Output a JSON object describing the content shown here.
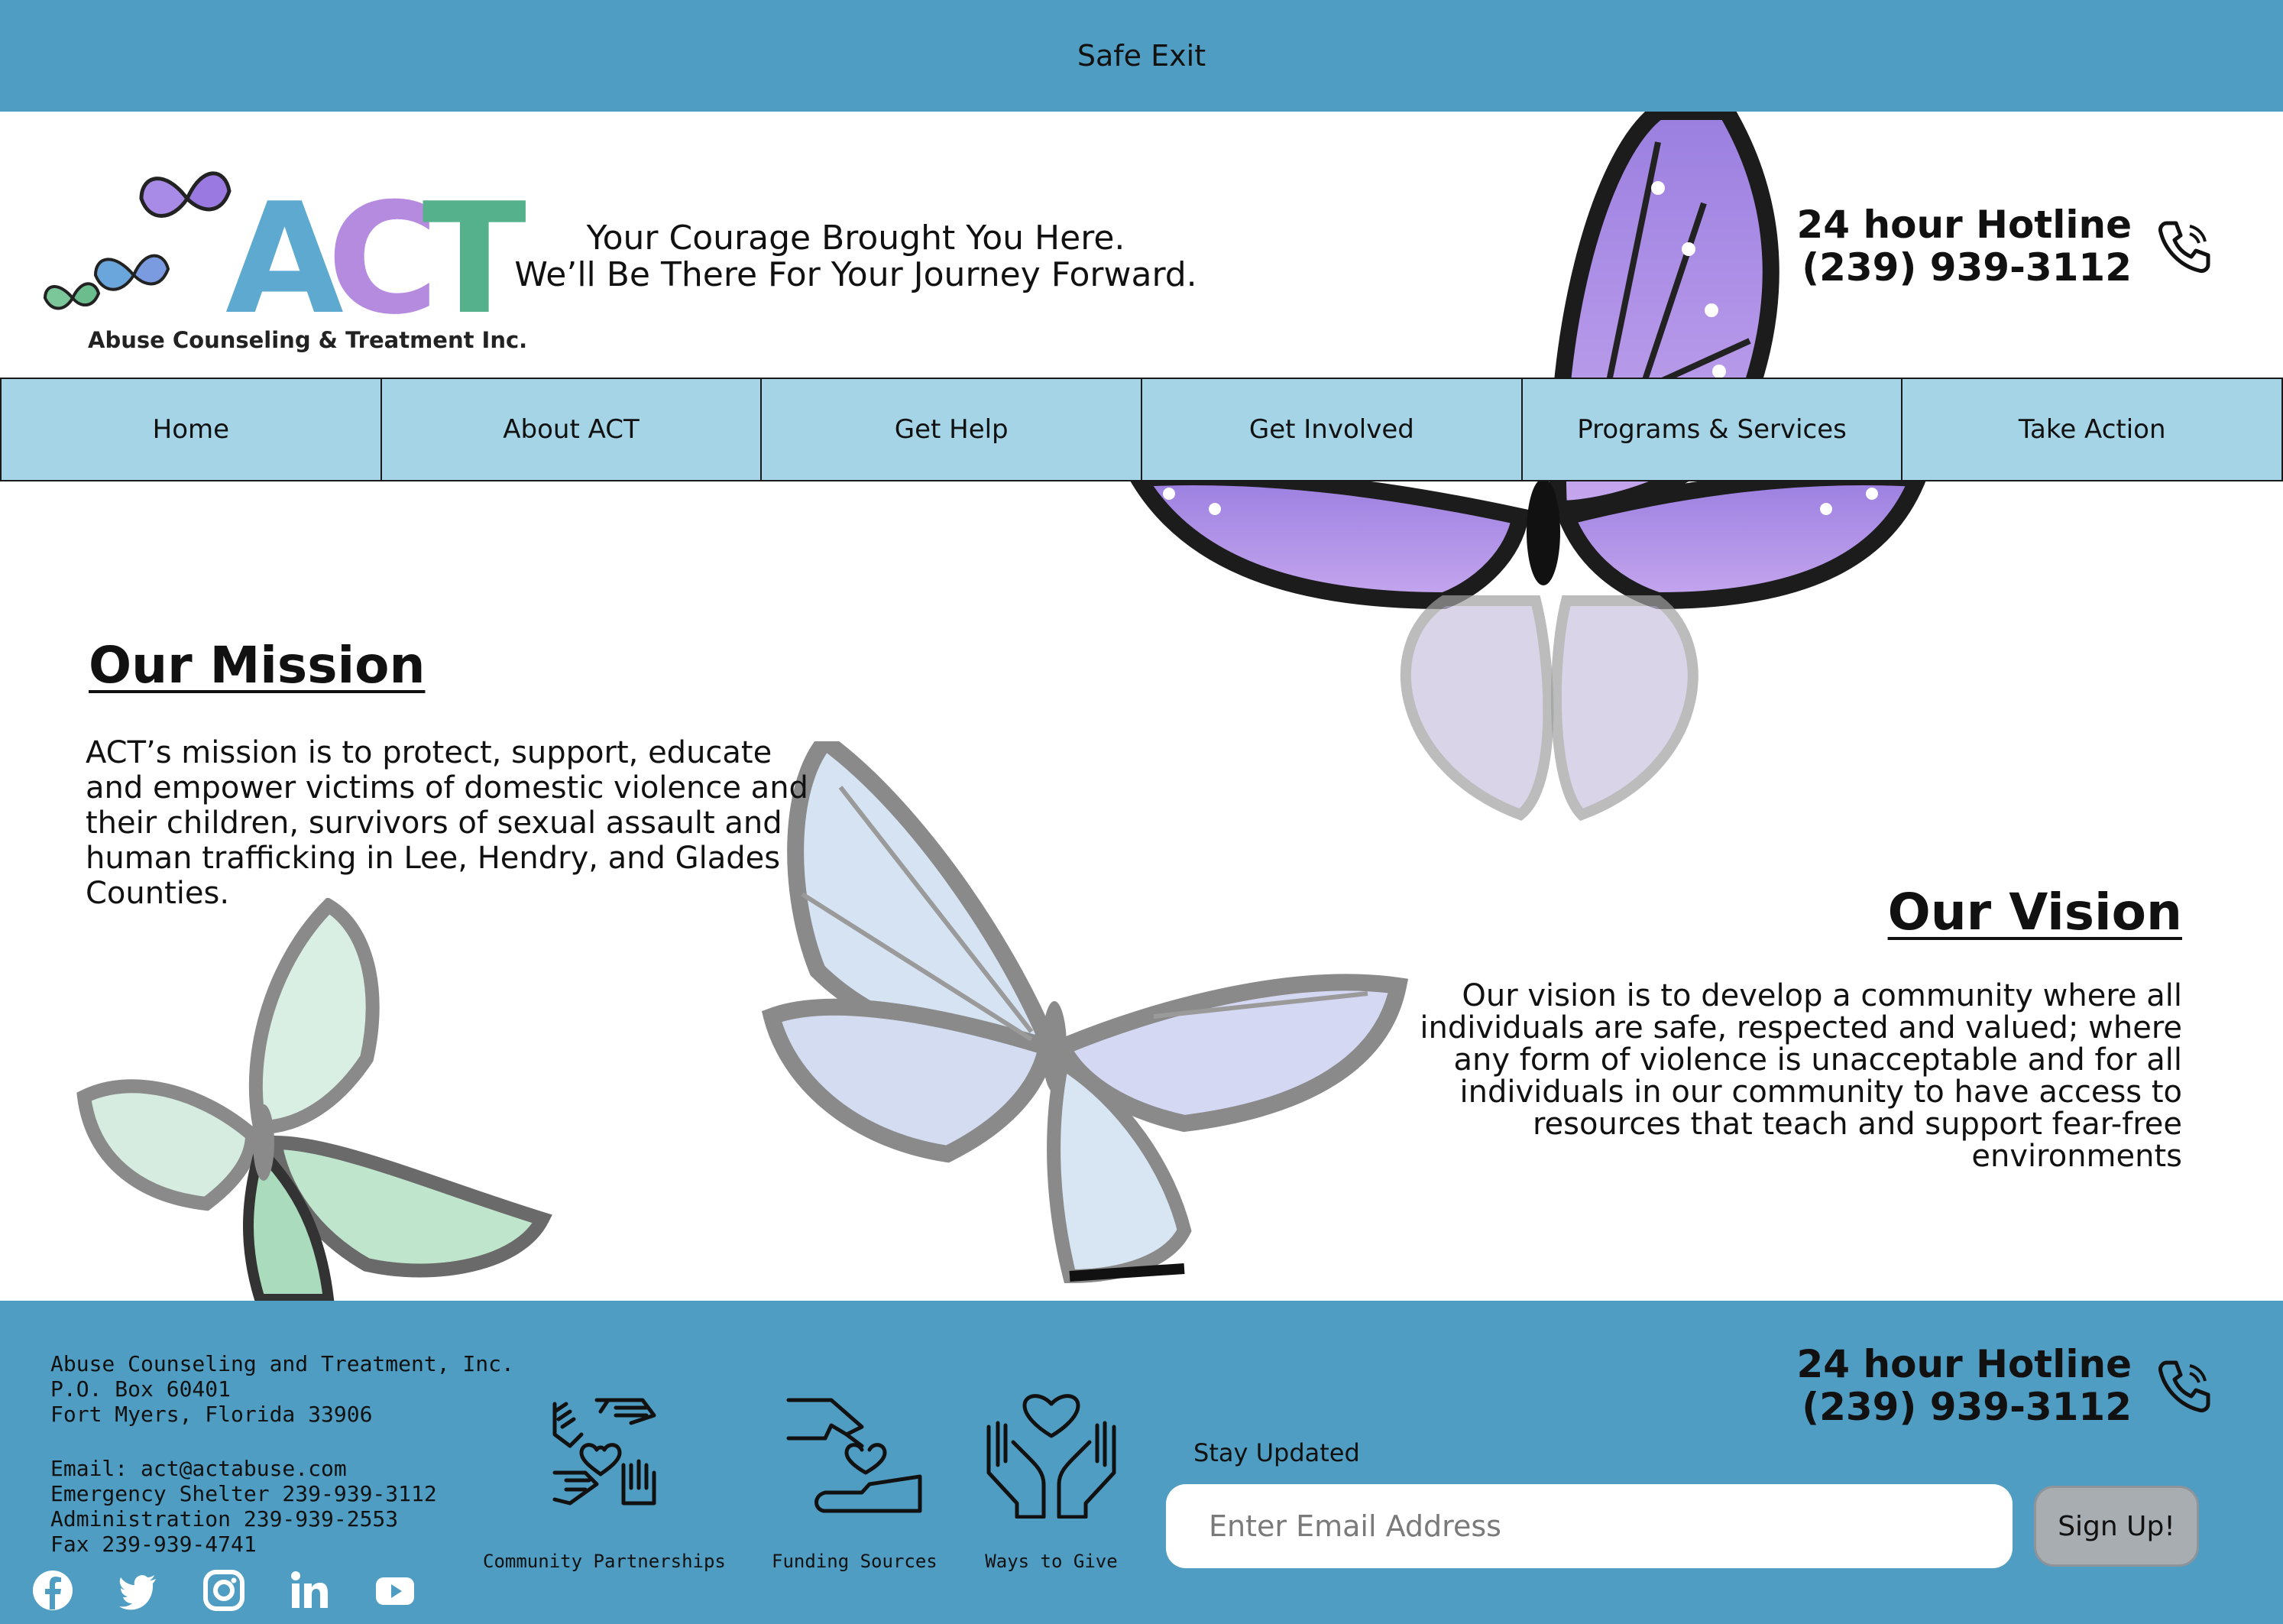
{
  "top_bar": {
    "safe_exit_label": "Safe Exit"
  },
  "header": {
    "logo": {
      "letters": [
        "A",
        "C",
        "T"
      ],
      "subtitle": "Abuse Counseling & Treatment Inc."
    },
    "tagline_line1": "Your Courage Brought You Here.",
    "tagline_line2": "We’ll Be There For Your Journey Forward.",
    "hotline": {
      "label": "24 hour Hotline",
      "number": "(239) 939-3112",
      "icon": "phone-icon"
    }
  },
  "nav": {
    "items": [
      {
        "label": "Home"
      },
      {
        "label": "About ACT"
      },
      {
        "label": "Get Help"
      },
      {
        "label": "Get Involved"
      },
      {
        "label": "Programs & Services"
      },
      {
        "label": "Take Action"
      }
    ]
  },
  "mission": {
    "title": "Our Mission",
    "text": "ACT’s mission is to protect, support, educate and empower victims of domestic violence and their children, survivors of sexual assault and human trafficking in Lee, Hendry, and Glades Counties."
  },
  "vision": {
    "title": "Our Vision",
    "text": "Our vision is to develop a community where all individuals are safe, respected and valued; where any form of violence is unacceptable and for all individuals in our community to have access to resources that teach and support fear-free environments"
  },
  "footer": {
    "contact": {
      "org": "Abuse Counseling and Treatment, Inc.",
      "po_box": "P.O. Box 60401",
      "city": "Fort Myers, Florida 33906",
      "email": "Email: act@actabuse.com",
      "shelter": "Emergency Shelter 239-939-3112",
      "admin": "Administration 239-939-2553",
      "fax": "Fax 239-939-4741"
    },
    "socials": [
      "facebook-icon",
      "twitter-icon",
      "instagram-icon",
      "linkedin-icon",
      "youtube-icon"
    ],
    "features": [
      {
        "label": "Community Partnerships",
        "icon": "hands-circle-icon"
      },
      {
        "label": "Funding Sources",
        "icon": "hand-giving-heart-icon"
      },
      {
        "label": "Ways to Give",
        "icon": "hands-holding-heart-icon"
      }
    ],
    "hotline": {
      "label": "24 hour Hotline",
      "number": "(239) 939-3112"
    },
    "newsletter": {
      "label": "Stay Updated",
      "placeholder": "Enter Email Address",
      "button_label": "Sign Up!"
    }
  },
  "colors": {
    "top_bar": "#4f9dc2",
    "nav": "#a4d4e6",
    "footer": "#4f9dc2",
    "logo_a": "#5ea9cf",
    "logo_c": "#b58be0",
    "logo_t": "#55b08c"
  }
}
